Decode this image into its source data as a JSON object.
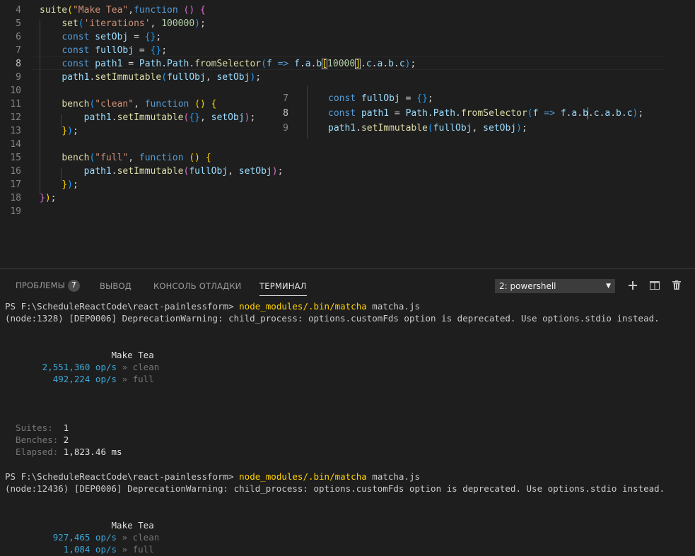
{
  "editor": {
    "lines": [
      {
        "n": "4",
        "tokens": [
          [
            "fn",
            "suite"
          ],
          [
            "b1",
            "("
          ],
          [
            "str",
            "\"Make Tea\""
          ],
          [
            "",
            ","
          ],
          [
            "kw",
            "function"
          ],
          [
            "",
            " "
          ],
          [
            "b2",
            "()"
          ],
          [
            "",
            " "
          ],
          [
            "b2",
            "{"
          ]
        ]
      },
      {
        "n": "5",
        "tokens": [
          [
            "",
            "    "
          ],
          [
            "fn",
            "set"
          ],
          [
            "b3",
            "("
          ],
          [
            "str",
            "'iterations'"
          ],
          [
            "",
            ", "
          ],
          [
            "num",
            "100000"
          ],
          [
            "b3",
            ")"
          ],
          [
            "",
            ";"
          ]
        ]
      },
      {
        "n": "6",
        "tokens": [
          [
            "",
            "    "
          ],
          [
            "kw",
            "const"
          ],
          [
            "",
            " "
          ],
          [
            "var",
            "setObj"
          ],
          [
            "",
            " = "
          ],
          [
            "b3",
            "{}"
          ],
          [
            "",
            ";"
          ]
        ]
      },
      {
        "n": "7",
        "tokens": [
          [
            "",
            "    "
          ],
          [
            "kw",
            "const"
          ],
          [
            "",
            " "
          ],
          [
            "var",
            "fullObj"
          ],
          [
            "",
            " = "
          ],
          [
            "b3",
            "{}"
          ],
          [
            "",
            ";"
          ]
        ]
      },
      {
        "n": "8",
        "tokens": [
          [
            "",
            "    "
          ],
          [
            "kw",
            "const"
          ],
          [
            "",
            " "
          ],
          [
            "var",
            "path1"
          ],
          [
            "",
            " = "
          ],
          [
            "var",
            "Path"
          ],
          [
            "",
            "."
          ],
          [
            "var",
            "Path"
          ],
          [
            "",
            "."
          ],
          [
            "fn",
            "fromSelector"
          ],
          [
            "b3",
            "("
          ],
          [
            "var",
            "f"
          ],
          [
            "",
            " "
          ],
          [
            "kw",
            "=>"
          ],
          [
            "",
            " "
          ],
          [
            "var",
            "f"
          ],
          [
            "",
            "."
          ],
          [
            "var",
            "a"
          ],
          [
            "",
            "."
          ],
          [
            "var",
            "b"
          ],
          [
            "b1box",
            "["
          ],
          [
            "num",
            "10000"
          ],
          [
            "b1box",
            "]"
          ],
          [
            "",
            "."
          ],
          [
            "var",
            "c"
          ],
          [
            "",
            "."
          ],
          [
            "var",
            "a"
          ],
          [
            "",
            "."
          ],
          [
            "var",
            "b"
          ],
          [
            "",
            "."
          ],
          [
            "var",
            "c"
          ],
          [
            "b3",
            ")"
          ],
          [
            "",
            ";"
          ]
        ]
      },
      {
        "n": "9",
        "tokens": [
          [
            "",
            "    "
          ],
          [
            "var",
            "path1"
          ],
          [
            "",
            "."
          ],
          [
            "fn",
            "setImmutable"
          ],
          [
            "b3",
            "("
          ],
          [
            "var",
            "fullObj"
          ],
          [
            "",
            ", "
          ],
          [
            "var",
            "setObj"
          ],
          [
            "b3",
            ")"
          ],
          [
            "",
            ";"
          ]
        ]
      },
      {
        "n": "10",
        "tokens": []
      },
      {
        "n": "11",
        "tokens": [
          [
            "",
            "    "
          ],
          [
            "fn",
            "bench"
          ],
          [
            "b3",
            "("
          ],
          [
            "str",
            "\"clean\""
          ],
          [
            "",
            ", "
          ],
          [
            "kw",
            "function"
          ],
          [
            "",
            " "
          ],
          [
            "b1",
            "()"
          ],
          [
            "",
            " "
          ],
          [
            "b1",
            "{"
          ]
        ]
      },
      {
        "n": "12",
        "tokens": [
          [
            "",
            "        "
          ],
          [
            "var",
            "path1"
          ],
          [
            "",
            "."
          ],
          [
            "fn",
            "setImmutable"
          ],
          [
            "b2",
            "("
          ],
          [
            "b3",
            "{}"
          ],
          [
            "",
            ", "
          ],
          [
            "var",
            "setObj"
          ],
          [
            "b2",
            ")"
          ],
          [
            "",
            ";"
          ]
        ]
      },
      {
        "n": "13",
        "tokens": [
          [
            "",
            "    "
          ],
          [
            "b1",
            "}"
          ],
          [
            "b3",
            ")"
          ],
          [
            "",
            ";"
          ]
        ]
      },
      {
        "n": "14",
        "tokens": []
      },
      {
        "n": "15",
        "tokens": [
          [
            "",
            "    "
          ],
          [
            "fn",
            "bench"
          ],
          [
            "b3",
            "("
          ],
          [
            "str",
            "\"full\""
          ],
          [
            "",
            ", "
          ],
          [
            "kw",
            "function"
          ],
          [
            "",
            " "
          ],
          [
            "b1",
            "()"
          ],
          [
            "",
            " "
          ],
          [
            "b1",
            "{"
          ]
        ]
      },
      {
        "n": "16",
        "tokens": [
          [
            "",
            "        "
          ],
          [
            "var",
            "path1"
          ],
          [
            "",
            "."
          ],
          [
            "fn",
            "setImmutable"
          ],
          [
            "b2",
            "("
          ],
          [
            "var",
            "fullObj"
          ],
          [
            "",
            ", "
          ],
          [
            "var",
            "setObj"
          ],
          [
            "b2",
            ")"
          ],
          [
            "",
            ";"
          ]
        ]
      },
      {
        "n": "17",
        "tokens": [
          [
            "",
            "    "
          ],
          [
            "b1",
            "}"
          ],
          [
            "b3",
            ")"
          ],
          [
            "",
            ";"
          ]
        ]
      },
      {
        "n": "18",
        "tokens": [
          [
            "b2",
            "}"
          ],
          [
            "b1",
            ")"
          ],
          [
            "",
            ";"
          ]
        ]
      },
      {
        "n": "19",
        "tokens": []
      }
    ],
    "active_line": "8"
  },
  "peek": {
    "lines": [
      {
        "n": "7",
        "tokens": [
          [
            "kw",
            "const"
          ],
          [
            "",
            " "
          ],
          [
            "var",
            "fullObj"
          ],
          [
            "",
            " = "
          ],
          [
            "b3",
            "{}"
          ],
          [
            "",
            ";"
          ]
        ]
      },
      {
        "n": "8",
        "tokens": [
          [
            "kw",
            "const"
          ],
          [
            "",
            " "
          ],
          [
            "var",
            "path1"
          ],
          [
            "",
            " = "
          ],
          [
            "var",
            "Path"
          ],
          [
            "",
            "."
          ],
          [
            "var",
            "Path"
          ],
          [
            "",
            "."
          ],
          [
            "fn",
            "fromSelector"
          ],
          [
            "b3",
            "("
          ],
          [
            "var",
            "f"
          ],
          [
            "",
            " "
          ],
          [
            "kw",
            "=>"
          ],
          [
            "",
            " "
          ],
          [
            "var",
            "f"
          ],
          [
            "",
            "."
          ],
          [
            "var",
            "a"
          ],
          [
            "",
            "."
          ],
          [
            "var",
            "b"
          ],
          [
            "cursor",
            ""
          ],
          [
            "",
            "."
          ],
          [
            "var",
            "c"
          ],
          [
            "",
            "."
          ],
          [
            "var",
            "a"
          ],
          [
            "",
            "."
          ],
          [
            "var",
            "b"
          ],
          [
            "",
            "."
          ],
          [
            "var",
            "c"
          ],
          [
            "b3",
            ")"
          ],
          [
            "",
            ";"
          ]
        ]
      },
      {
        "n": "9",
        "tokens": [
          [
            "var",
            "path1"
          ],
          [
            "",
            "."
          ],
          [
            "fn",
            "setImmutable"
          ],
          [
            "b3",
            "("
          ],
          [
            "var",
            "fullObj"
          ],
          [
            "",
            ", "
          ],
          [
            "var",
            "setObj"
          ],
          [
            "b3",
            ")"
          ],
          [
            "",
            ";"
          ]
        ]
      }
    ]
  },
  "panel": {
    "tabs": {
      "problems": "ПРОБЛЕМЫ",
      "problems_count": "7",
      "output": "ВЫВОД",
      "debug_console": "КОНСОЛЬ ОТЛАДКИ",
      "terminal": "ТЕРМИНАЛ"
    },
    "shell_select": "2: powershell",
    "icons": [
      "plus-icon",
      "split-icon",
      "trash-icon"
    ]
  },
  "terminal": {
    "lines": [
      [
        [
          "",
          "PS F:\\ScheduleReactCode\\react-painlessform> "
        ],
        [
          "yellow",
          "node_modules/.bin/matcha"
        ],
        [
          "",
          " matcha.js"
        ]
      ],
      [
        [
          "",
          "(node:1328) [DEP0006] DeprecationWarning: child_process: options.customFds option is deprecated. Use options.stdio instead."
        ]
      ],
      [],
      [],
      [
        [
          "white",
          "                    Make Tea"
        ]
      ],
      [
        [
          "cyan",
          "       2,551,360 op/s"
        ],
        [
          "gray",
          " » clean"
        ]
      ],
      [
        [
          "cyan",
          "         492,224 op/s"
        ],
        [
          "gray",
          " » full"
        ]
      ],
      [],
      [],
      [],
      [
        [
          "gray",
          "  Suites:  "
        ],
        [
          "white",
          "1"
        ]
      ],
      [
        [
          "gray",
          "  Benches: "
        ],
        [
          "white",
          "2"
        ]
      ],
      [
        [
          "gray",
          "  Elapsed: "
        ],
        [
          "white",
          "1,823.46 ms"
        ]
      ],
      [],
      [
        [
          "",
          "PS F:\\ScheduleReactCode\\react-painlessform> "
        ],
        [
          "yellow",
          "node_modules/.bin/matcha"
        ],
        [
          "",
          " matcha.js"
        ]
      ],
      [
        [
          "",
          "(node:12436) [DEP0006] DeprecationWarning: child_process: options.customFds option is deprecated. Use options.stdio instead."
        ]
      ],
      [],
      [],
      [
        [
          "white",
          "                    Make Tea"
        ]
      ],
      [
        [
          "cyan",
          "         927,465 op/s"
        ],
        [
          "gray",
          " » clean"
        ]
      ],
      [
        [
          "cyan",
          "           1,084 op/s"
        ],
        [
          "gray",
          " » full"
        ]
      ]
    ]
  }
}
